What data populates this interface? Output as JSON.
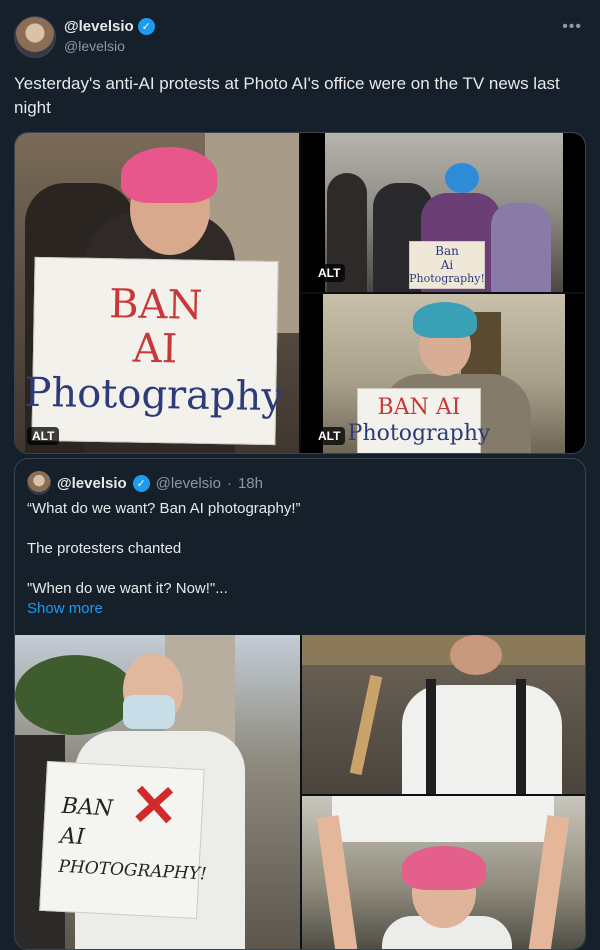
{
  "post": {
    "author_name": "@levelsio",
    "author_handle": "@levelsio",
    "more_icon": "more-horizontal-icon",
    "text": "Yesterday's anti-AI protests at Photo AI's office were on the TV news last night",
    "alt_label": "ALT",
    "images": [
      {
        "sign_lines": [
          "BAN",
          "AI",
          "Photography"
        ]
      },
      {
        "sign_lines": [
          "Ban",
          "Ai",
          "Photography!"
        ]
      },
      {
        "sign_lines": [
          "BAN AI",
          "Photography"
        ]
      }
    ]
  },
  "quote": {
    "author_name": "@levelsio",
    "author_handle": "@levelsio",
    "dot": "·",
    "time": "18h",
    "lines": [
      "“What do we want? Ban AI photography!”",
      "The protesters chanted",
      "\"When do we want it? Now!\"..."
    ],
    "show_more": "Show more",
    "images": [
      {
        "sign_lines": [
          "BAN",
          "AI",
          "PHOTOGRAPHY!"
        ]
      }
    ]
  },
  "colors": {
    "background": "#15202b",
    "border": "#38444d",
    "link": "#1d9bf0",
    "muted": "#8b98a5"
  }
}
